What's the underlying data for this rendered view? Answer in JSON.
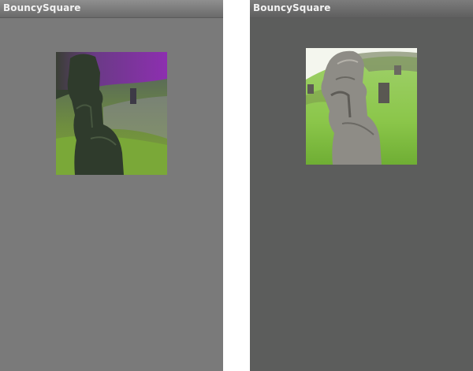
{
  "screens": [
    {
      "title": "BouncySquare",
      "image": {
        "subject": "moai-statue-photo",
        "style": "color-inverted-purple-tint"
      }
    },
    {
      "title": "BouncySquare",
      "image": {
        "subject": "moai-statue-photo",
        "style": "natural"
      }
    }
  ],
  "colors": {
    "left_background": "#7a7a7a",
    "right_background": "#5c5d5c",
    "divider": "#ffffff"
  }
}
